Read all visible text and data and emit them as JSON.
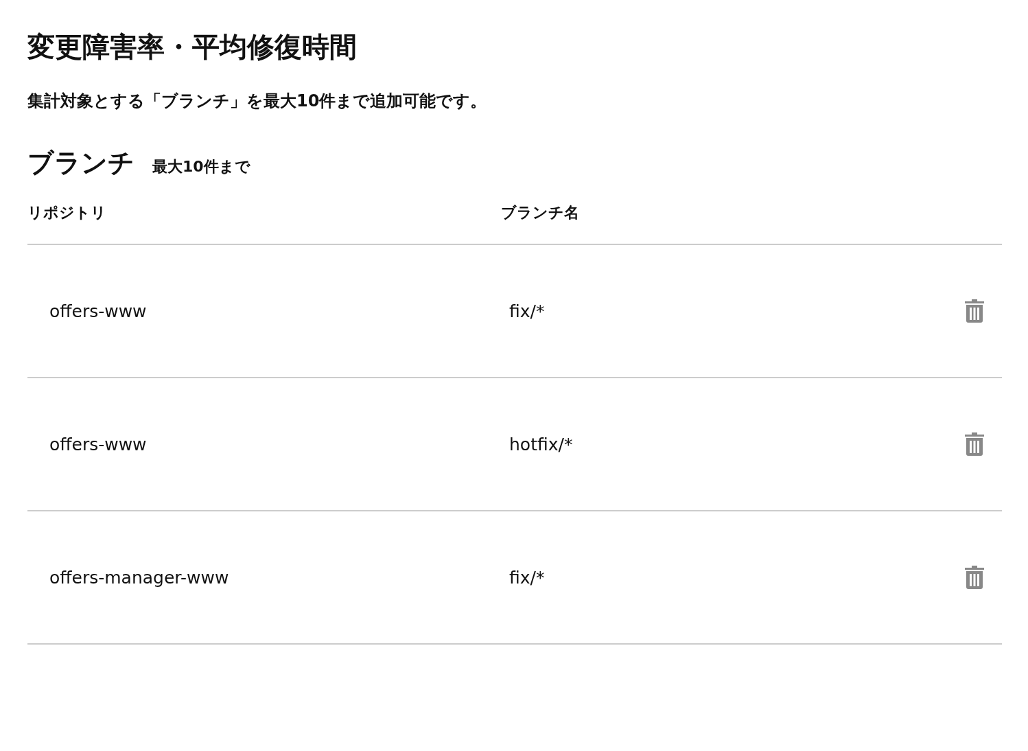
{
  "title": "変更障害率・平均修復時間",
  "description": "集計対象とする「ブランチ」を最大10件まで追加可能です。",
  "section": {
    "heading": "ブランチ",
    "note": "最大10件まで"
  },
  "table": {
    "columns": [
      "リポジトリ",
      "ブランチ名"
    ],
    "rows": [
      {
        "repository": "offers-www",
        "branch": "fix/*"
      },
      {
        "repository": "offers-www",
        "branch": "hotfix/*"
      },
      {
        "repository": "offers-manager-www",
        "branch": "fix/*"
      }
    ]
  }
}
